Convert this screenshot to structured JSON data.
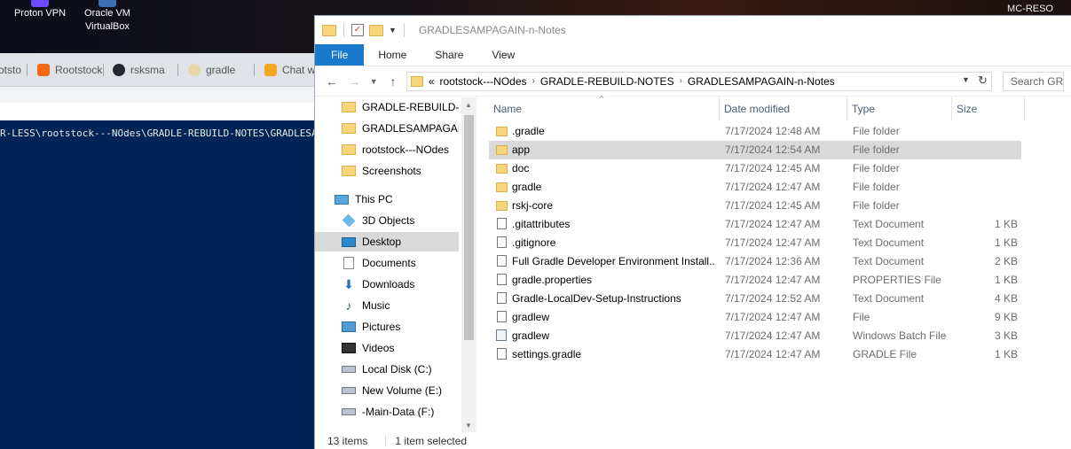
{
  "desktop": {
    "icons": [
      {
        "label": "Proton VPN"
      },
      {
        "label1": "Oracle VM",
        "label2": "VirtualBox"
      }
    ],
    "right_label": "MC-RESO"
  },
  "browser": {
    "tabs": [
      "otsto",
      "Rootstock",
      "rsksma",
      "gradle",
      "Chat w"
    ]
  },
  "terminal": {
    "line": "R-LESS\\rootstock---NOdes\\GRADLE-REBUILD-NOTES\\GRADLESAMPAGAIN-n-Notes"
  },
  "explorer": {
    "title": "GRADLESAMPAGAIN-n-Notes",
    "ribbon_tabs": {
      "file": "File",
      "home": "Home",
      "share": "Share",
      "view": "View"
    },
    "address": {
      "overflow": "«",
      "crumbs": [
        "rootstock---NOdes",
        "GRADLE-REBUILD-NOTES",
        "GRADLESAMPAGAIN-n-Notes"
      ]
    },
    "search_placeholder": "Search GRA",
    "nav": {
      "quick": [
        "GRADLE-REBUILD-NOTES",
        "GRADLESAMPAGAIN",
        "rootstock---NOdes",
        "Screenshots"
      ],
      "this_pc": "This PC",
      "pc_items": [
        "3D Objects",
        "Desktop",
        "Documents",
        "Downloads",
        "Music",
        "Pictures",
        "Videos",
        "Local Disk (C:)",
        "New Volume (E:)",
        "-Main-Data (F:)"
      ]
    },
    "columns": {
      "name": "Name",
      "date": "Date modified",
      "type": "Type",
      "size": "Size"
    },
    "files": [
      {
        "name": ".gradle",
        "date": "7/17/2024 12:48 AM",
        "type": "File folder",
        "size": "",
        "kind": "folder"
      },
      {
        "name": "app",
        "date": "7/17/2024 12:54 AM",
        "type": "File folder",
        "size": "",
        "kind": "folder"
      },
      {
        "name": "doc",
        "date": "7/17/2024 12:45 AM",
        "type": "File folder",
        "size": "",
        "kind": "folder"
      },
      {
        "name": "gradle",
        "date": "7/17/2024 12:47 AM",
        "type": "File folder",
        "size": "",
        "kind": "folder"
      },
      {
        "name": "rskj-core",
        "date": "7/17/2024 12:45 AM",
        "type": "File folder",
        "size": "",
        "kind": "folder"
      },
      {
        "name": ".gitattributes",
        "date": "7/17/2024 12:47 AM",
        "type": "Text Document",
        "size": "1 KB",
        "kind": "file"
      },
      {
        "name": ".gitignore",
        "date": "7/17/2024 12:47 AM",
        "type": "Text Document",
        "size": "1 KB",
        "kind": "file"
      },
      {
        "name": "Full Gradle Developer Environment Install...",
        "date": "7/17/2024 12:36 AM",
        "type": "Text Document",
        "size": "2 KB",
        "kind": "file"
      },
      {
        "name": "gradle.properties",
        "date": "7/17/2024 12:47 AM",
        "type": "PROPERTIES File",
        "size": "1 KB",
        "kind": "file"
      },
      {
        "name": "Gradle-LocalDev-Setup-Instructions",
        "date": "7/17/2024 12:52 AM",
        "type": "Text Document",
        "size": "4 KB",
        "kind": "file"
      },
      {
        "name": "gradlew",
        "date": "7/17/2024 12:47 AM",
        "type": "File",
        "size": "9 KB",
        "kind": "file"
      },
      {
        "name": "gradlew",
        "date": "7/17/2024 12:47 AM",
        "type": "Windows Batch File",
        "size": "3 KB",
        "kind": "batch"
      },
      {
        "name": "settings.gradle",
        "date": "7/17/2024 12:47 AM",
        "type": "GRADLE File",
        "size": "1 KB",
        "kind": "file"
      }
    ],
    "selected_index": 1,
    "status": {
      "count": "13 items",
      "selected": "1 item selected"
    }
  }
}
